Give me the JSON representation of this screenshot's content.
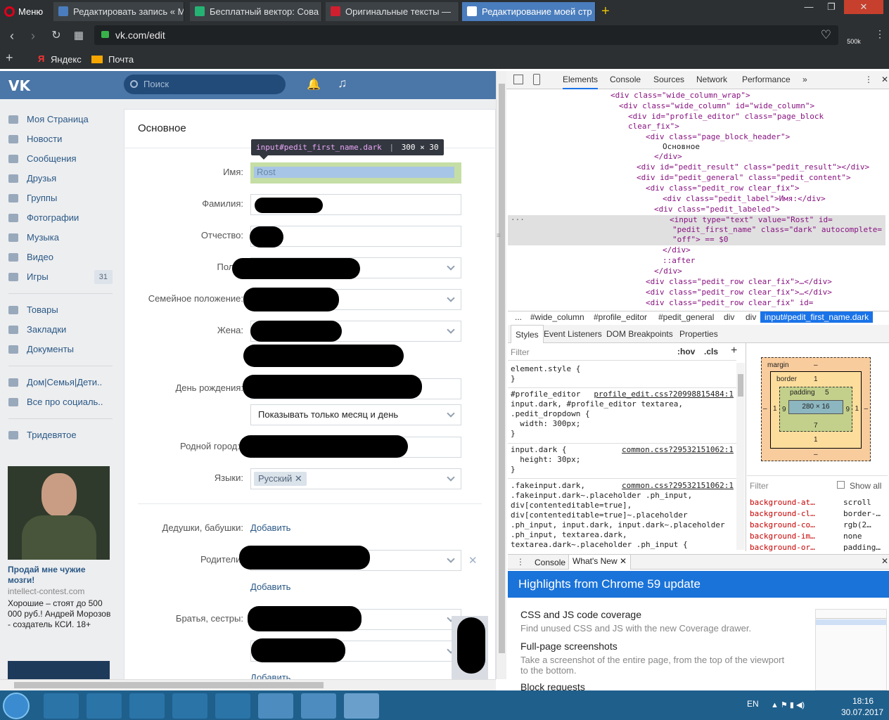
{
  "browser": {
    "menu_label": "Меню",
    "tabs": [
      {
        "label": "Редактировать запись « M",
        "color": "#4a7dbd"
      },
      {
        "label": "Бесплатный вектор: Сова",
        "color": "#25b373"
      },
      {
        "label": "Оригинальные тексты —",
        "color": "#d0202f"
      },
      {
        "label": "Редактирование моей стр",
        "color": "#4a76a8"
      }
    ],
    "new_tab": "+",
    "url": "vk.com/edit",
    "badge": "500k",
    "bookmarks": [
      "Яндекс",
      "Почта"
    ]
  },
  "vk": {
    "search_placeholder": "Поиск",
    "sidebar": [
      {
        "label": "Моя Страница"
      },
      {
        "label": "Новости"
      },
      {
        "label": "Сообщения"
      },
      {
        "label": "Друзья"
      },
      {
        "label": "Группы"
      },
      {
        "label": "Фотографии"
      },
      {
        "label": "Музыка"
      },
      {
        "label": "Видео"
      },
      {
        "label": "Игры",
        "count": "31"
      },
      {
        "label": "Товары"
      },
      {
        "label": "Закладки"
      },
      {
        "label": "Документы"
      },
      {
        "label": "Дом|Семья|Дети.."
      },
      {
        "label": "Все про социаль.."
      },
      {
        "label": "Тридевятое"
      }
    ],
    "ad": {
      "title": "Продай мне чужие мозги!",
      "domain": "intellect-contest.com",
      "text": "Хорошие – стоят до 500 000 руб.! Андрей Морозов - создатель КСИ. 18+"
    },
    "section_title": "Основное",
    "tooltip": {
      "selector": "input#pedit_first_name.dark",
      "size": "300 × 30"
    },
    "fields": {
      "first_name_label": "Имя:",
      "first_name_value": "Rost",
      "last_name_label": "Фамилия:",
      "patronymic_label": "Отчество:",
      "gender_label": "Пол:",
      "family_label": "Семейное положение:",
      "spouse_label": "Жена:",
      "birthday_label": "День рождения:",
      "birthday_visibility": "Показывать только месяц и день",
      "hometown_label": "Родной город:",
      "languages_label": "Языки:",
      "language_chip": "Русский",
      "grandparents_label": "Дедушки, бабушки:",
      "add": "Добавить",
      "parents_label": "Родители:",
      "siblings_label": "Братья, сестры:"
    }
  },
  "devtools": {
    "tabs": [
      "Elements",
      "Console",
      "Sources",
      "Network",
      "Performance"
    ],
    "dom_lines": [
      "<div class=\"wide_column_wrap\">",
      "<div class=\"wide_column\" id=\"wide_column\">",
      "<div id=\"profile_editor\" class=\"page_block",
      "clear_fix\">",
      "<div class=\"page_block_header\">",
      "Основное",
      "</div>",
      "<div id=\"pedit_result\" class=\"pedit_result\"></div>",
      "<div id=\"pedit_general\" class=\"pedit_content\">",
      "<div class=\"pedit_row clear_fix\">",
      "<div class=\"pedit_label\">Имя:</div>",
      "<div class=\"pedit_labeled\">",
      "<input type=\"text\" value=\"Rost\" id=",
      "\"pedit_first_name\" class=\"dark\" autocomplete=",
      "\"off\"> == $0",
      "</div>",
      "::after",
      "</div>",
      "<div class=\"pedit_row clear_fix\">…</div>",
      "<div class=\"pedit_row clear_fix\">…</div>",
      "<div class=\"pedit_row clear_fix\" id="
    ],
    "breadcrumbs": [
      "...",
      "#wide_column",
      "#profile_editor",
      "#pedit_general",
      "div",
      "div",
      "input#pedit_first_name.dark"
    ],
    "styles_tabs": [
      "Styles",
      "Event Listeners",
      "DOM Breakpoints",
      "Properties"
    ],
    "filter": "Filter",
    "hov": ":hov",
    "cls": ".cls",
    "rules": [
      {
        "text": "element.style {\n}",
        "source": ""
      },
      {
        "text": "#profile_editor\ninput.dark, #profile_editor textarea,\n.pedit_dropdown {\n  width: 300px;\n}",
        "source": "profile_edit.css?20998815484:1"
      },
      {
        "text": "input.dark {\n  height: 30px;\n}",
        "source": "common.css?29532151062:1"
      },
      {
        "text": ".fakeinput.dark,\n.fakeinput.dark~.placeholder .ph_input,\ndiv[contenteditable=true],\ndiv[contenteditable=true]~.placeholder\n.ph_input, input.dark, input.dark~.placeholder\n.ph_input, textarea.dark,\ntextarea.dark~.placeholder .ph_input {",
        "source": "common.css?29532151062:1"
      }
    ],
    "box_model": {
      "margin": "margin",
      "margin_val": "–",
      "border": "border",
      "border_val": "1",
      "padding": "padding",
      "padding_val": "5",
      "content": "280 × 16",
      "side_left": "9",
      "side_right": "9",
      "bottom_pad": "7",
      "bottom_border": "1",
      "bottom_margin": "–",
      "left_margin": "–",
      "right_margin": "–",
      "left_border": "1",
      "right_border": "1"
    },
    "computed_filter": "Filter",
    "show_all": "Show all",
    "computed": [
      {
        "prop": "background-at…",
        "val": "scroll"
      },
      {
        "prop": "background-cl…",
        "val": "border-…"
      },
      {
        "prop": "background-co…",
        "val": "rgb(2…"
      },
      {
        "prop": "background-im…",
        "val": "none"
      },
      {
        "prop": "background-or…",
        "val": "padding…"
      }
    ],
    "drawer_tabs": [
      "Console",
      "What's New"
    ],
    "whats_new_title": "Highlights from Chrome 59 update",
    "features": [
      {
        "title": "CSS and JS code coverage",
        "desc": "Find unused CSS and JS with the new Coverage drawer."
      },
      {
        "title": "Full-page screenshots",
        "desc": "Take a screenshot of the entire page, from the top of the viewport to the bottom."
      },
      {
        "title": "Block requests",
        "desc": ""
      }
    ]
  },
  "taskbar": {
    "lang": "EN",
    "time": "18:16",
    "date": "30.07.2017"
  }
}
